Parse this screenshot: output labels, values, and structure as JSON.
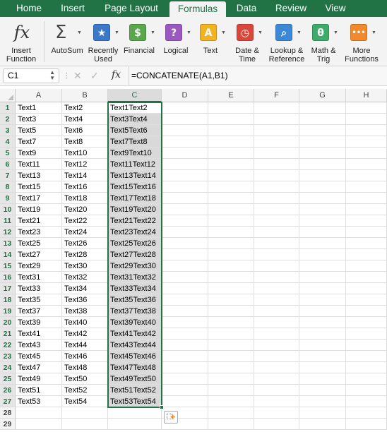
{
  "ribbon_tabs": [
    {
      "label": "Home",
      "active": false
    },
    {
      "label": "Insert",
      "active": false
    },
    {
      "label": "Page Layout",
      "active": false
    },
    {
      "label": "Formulas",
      "active": true
    },
    {
      "label": "Data",
      "active": false
    },
    {
      "label": "Review",
      "active": false
    },
    {
      "label": "View",
      "active": false
    }
  ],
  "ribbon_buttons": {
    "insert_function": {
      "line1": "Insert",
      "line2": "Function",
      "icon": "fx-icon"
    },
    "autosum": {
      "label": "AutoSum",
      "icon": "sigma-icon",
      "glyph": "Σ"
    },
    "recently_used": {
      "line1": "Recently",
      "line2": "Used",
      "icon": "star-icon",
      "glyph": "★",
      "color": "#3a78c9"
    },
    "financial": {
      "label": "Financial",
      "icon": "financial-icon",
      "glyph": "$",
      "color": "#5aa84b"
    },
    "logical": {
      "label": "Logical",
      "icon": "logical-icon",
      "glyph": "?",
      "color": "#9a58c0"
    },
    "text": {
      "label": "Text",
      "icon": "text-icon",
      "glyph": "A",
      "color": "#f2b322"
    },
    "date_time": {
      "line1": "Date &",
      "line2": "Time",
      "icon": "clock-icon",
      "glyph": "◷",
      "color": "#d9473b"
    },
    "lookup_reference": {
      "line1": "Lookup &",
      "line2": "Reference",
      "icon": "lookup-icon",
      "glyph": "⌕",
      "color": "#3a88d6"
    },
    "math_trig": {
      "line1": "Math &",
      "line2": "Trig",
      "icon": "theta-icon",
      "glyph": "θ",
      "color": "#3eab6a"
    },
    "more_functions": {
      "line1": "More",
      "line2": "Functions",
      "icon": "more-icon",
      "glyph": "•••",
      "color": "#f08a2c"
    }
  },
  "formula_bar": {
    "name_box": "C1",
    "formula": "=CONCATENATE(A1,B1)",
    "fx_label": "fx"
  },
  "columns": [
    "A",
    "B",
    "C",
    "D",
    "E",
    "F",
    "G",
    "H"
  ],
  "selected_column": "C",
  "rows": [
    [
      "1",
      "Text1",
      "Text2",
      "Text1Text2"
    ],
    [
      "2",
      "Text3",
      "Text4",
      "Text3Text4"
    ],
    [
      "3",
      "Text5",
      "Text6",
      "Text5Text6"
    ],
    [
      "4",
      "Text7",
      "Text8",
      "Text7Text8"
    ],
    [
      "5",
      "Text9",
      "Text10",
      "Text9Text10"
    ],
    [
      "6",
      "Text11",
      "Text12",
      "Text11Text12"
    ],
    [
      "7",
      "Text13",
      "Text14",
      "Text13Text14"
    ],
    [
      "8",
      "Text15",
      "Text16",
      "Text15Text16"
    ],
    [
      "9",
      "Text17",
      "Text18",
      "Text17Text18"
    ],
    [
      "10",
      "Text19",
      "Text20",
      "Text19Text20"
    ],
    [
      "11",
      "Text21",
      "Text22",
      "Text21Text22"
    ],
    [
      "12",
      "Text23",
      "Text24",
      "Text23Text24"
    ],
    [
      "13",
      "Text25",
      "Text26",
      "Text25Text26"
    ],
    [
      "14",
      "Text27",
      "Text28",
      "Text27Text28"
    ],
    [
      "15",
      "Text29",
      "Text30",
      "Text29Text30"
    ],
    [
      "16",
      "Text31",
      "Text32",
      "Text31Text32"
    ],
    [
      "17",
      "Text33",
      "Text34",
      "Text33Text34"
    ],
    [
      "18",
      "Text35",
      "Text36",
      "Text35Text36"
    ],
    [
      "19",
      "Text37",
      "Text38",
      "Text37Text38"
    ],
    [
      "20",
      "Text39",
      "Text40",
      "Text39Text40"
    ],
    [
      "21",
      "Text41",
      "Text42",
      "Text41Text42"
    ],
    [
      "22",
      "Text43",
      "Text44",
      "Text43Text44"
    ],
    [
      "23",
      "Text45",
      "Text46",
      "Text45Text46"
    ],
    [
      "24",
      "Text47",
      "Text48",
      "Text47Text48"
    ],
    [
      "25",
      "Text49",
      "Text50",
      "Text49Text50"
    ],
    [
      "26",
      "Text51",
      "Text52",
      "Text51Text52"
    ],
    [
      "27",
      "Text53",
      "Text54",
      "Text53Text54"
    ],
    [
      "28",
      "",
      "",
      ""
    ],
    [
      "29",
      "",
      "",
      ""
    ]
  ],
  "colors": {
    "accent": "#217346",
    "selection_fill": "#d9d9d9"
  }
}
